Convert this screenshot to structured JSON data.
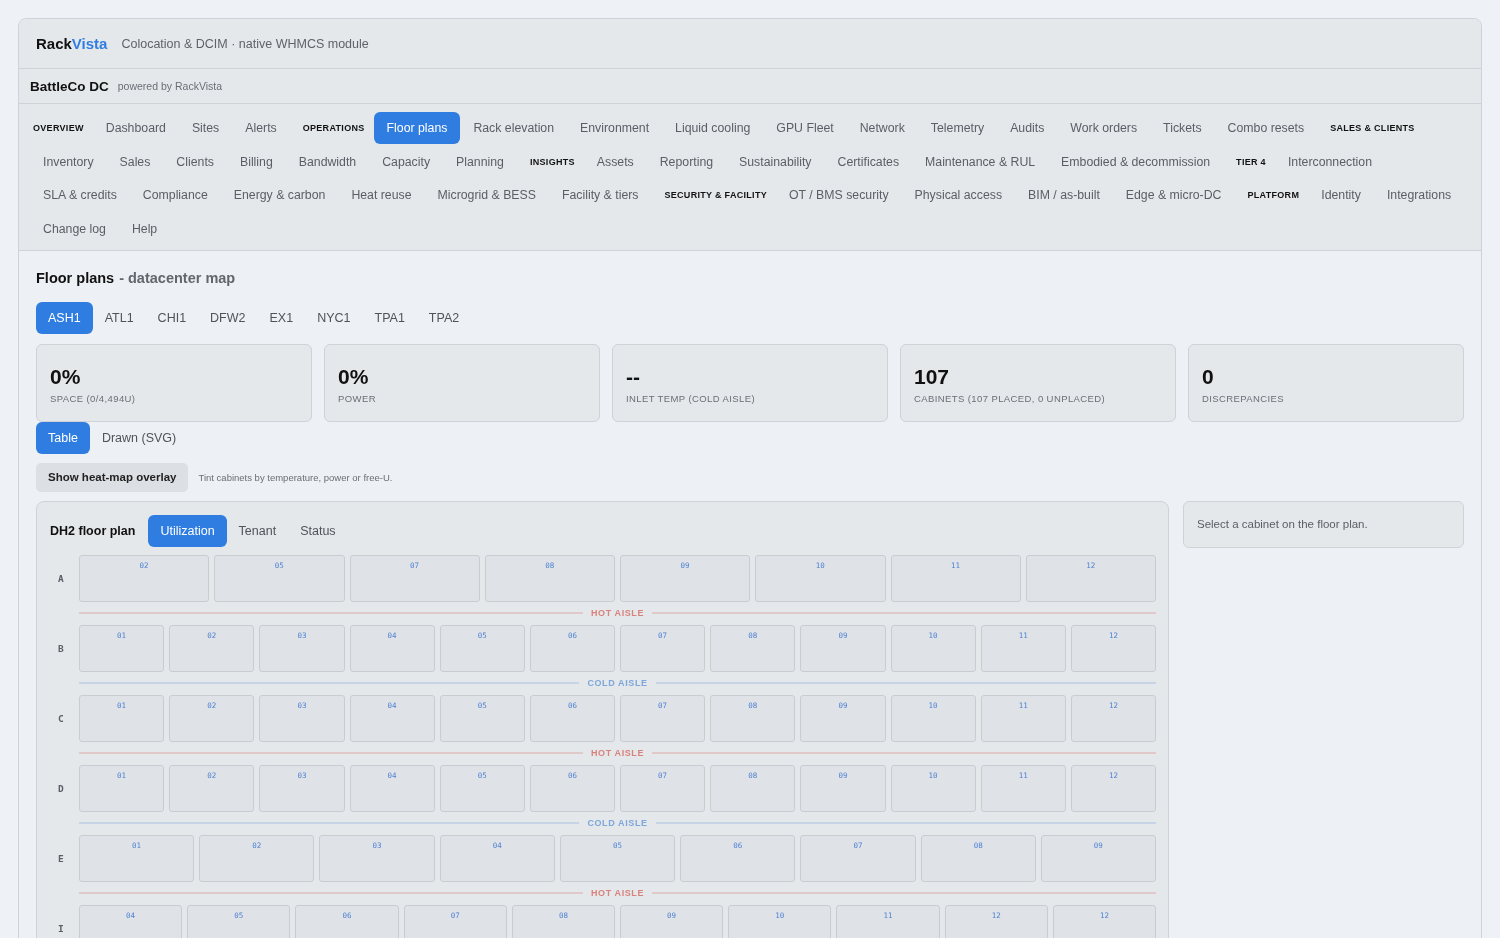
{
  "header": {
    "logo": {
      "prefix": "Rack",
      "accent": "Vista"
    },
    "tagline": "Colocation & DCIM · native WHMCS module"
  },
  "org": {
    "name": "BattleCo DC",
    "powered_by": "powered by RackVista"
  },
  "nav": {
    "items": [
      {
        "kind": "heading",
        "label": "OVERVIEW"
      },
      {
        "kind": "link",
        "label": "Dashboard",
        "selected": false
      },
      {
        "kind": "link",
        "label": "Sites",
        "selected": false
      },
      {
        "kind": "link",
        "label": "Alerts",
        "selected": false
      },
      {
        "kind": "heading",
        "label": "OPERATIONS"
      },
      {
        "kind": "link",
        "label": "Floor plans",
        "selected": true
      },
      {
        "kind": "link",
        "label": "Rack elevation",
        "selected": false
      },
      {
        "kind": "link",
        "label": "Environment",
        "selected": false
      },
      {
        "kind": "link",
        "label": "Liquid cooling",
        "selected": false
      },
      {
        "kind": "link",
        "label": "GPU Fleet",
        "selected": false
      },
      {
        "kind": "link",
        "label": "Network",
        "selected": false
      },
      {
        "kind": "link",
        "label": "Telemetry",
        "selected": false
      },
      {
        "kind": "link",
        "label": "Audits",
        "selected": false
      },
      {
        "kind": "link",
        "label": "Work orders",
        "selected": false
      },
      {
        "kind": "link",
        "label": "Tickets",
        "selected": false
      },
      {
        "kind": "link",
        "label": "Combo resets",
        "selected": false
      },
      {
        "kind": "heading",
        "label": "SALES & CLIENTS"
      },
      {
        "kind": "link",
        "label": "Inventory",
        "selected": false
      },
      {
        "kind": "link",
        "label": "Sales",
        "selected": false
      },
      {
        "kind": "link",
        "label": "Clients",
        "selected": false
      },
      {
        "kind": "link",
        "label": "Billing",
        "selected": false
      },
      {
        "kind": "link",
        "label": "Bandwidth",
        "selected": false
      },
      {
        "kind": "link",
        "label": "Capacity",
        "selected": false
      },
      {
        "kind": "link",
        "label": "Planning",
        "selected": false
      },
      {
        "kind": "heading",
        "label": "INSIGHTS"
      },
      {
        "kind": "link",
        "label": "Assets",
        "selected": false
      },
      {
        "kind": "link",
        "label": "Reporting",
        "selected": false
      },
      {
        "kind": "link",
        "label": "Sustainability",
        "selected": false
      },
      {
        "kind": "link",
        "label": "Certificates",
        "selected": false
      },
      {
        "kind": "link",
        "label": "Maintenance & RUL",
        "selected": false
      },
      {
        "kind": "link",
        "label": "Embodied & decommission",
        "selected": false
      },
      {
        "kind": "heading",
        "label": "TIER 4"
      },
      {
        "kind": "link",
        "label": "Interconnection",
        "selected": false
      },
      {
        "kind": "link",
        "label": "SLA & credits",
        "selected": false
      },
      {
        "kind": "link",
        "label": "Compliance",
        "selected": false
      },
      {
        "kind": "link",
        "label": "Energy & carbon",
        "selected": false
      },
      {
        "kind": "link",
        "label": "Heat reuse",
        "selected": false
      },
      {
        "kind": "link",
        "label": "Microgrid & BESS",
        "selected": false
      },
      {
        "kind": "link",
        "label": "Facility & tiers",
        "selected": false
      },
      {
        "kind": "heading",
        "label": "SECURITY & FACILITY"
      },
      {
        "kind": "link",
        "label": "OT / BMS security",
        "selected": false
      },
      {
        "kind": "link",
        "label": "Physical access",
        "selected": false
      },
      {
        "kind": "link",
        "label": "BIM / as-built",
        "selected": false
      },
      {
        "kind": "link",
        "label": "Edge & micro-DC",
        "selected": false
      },
      {
        "kind": "heading",
        "label": "PLATFORM"
      },
      {
        "kind": "link",
        "label": "Identity",
        "selected": false
      },
      {
        "kind": "link",
        "label": "Integrations",
        "selected": false
      },
      {
        "kind": "link",
        "label": "Change log",
        "selected": false
      },
      {
        "kind": "link",
        "label": "Help",
        "selected": false
      }
    ]
  },
  "page": {
    "title": "Floor plans",
    "subtitle": "- datacenter map"
  },
  "site_tabs": [
    {
      "label": "ASH1",
      "selected": true
    },
    {
      "label": "ATL1",
      "selected": false
    },
    {
      "label": "CHI1",
      "selected": false
    },
    {
      "label": "DFW2",
      "selected": false
    },
    {
      "label": "EX1",
      "selected": false
    },
    {
      "label": "NYC1",
      "selected": false
    },
    {
      "label": "TPA1",
      "selected": false
    },
    {
      "label": "TPA2",
      "selected": false
    }
  ],
  "stats": [
    {
      "value": "0%",
      "label": "SPACE (0/4,494U)"
    },
    {
      "value": "0%",
      "label": "POWER"
    },
    {
      "value": "--",
      "label": "INLET TEMP (COLD AISLE)"
    },
    {
      "value": "107",
      "label": "CABINETS (107 PLACED, 0 UNPLACED)"
    },
    {
      "value": "0",
      "label": "DISCREPANCIES"
    }
  ],
  "view_tabs": [
    {
      "label": "Table",
      "selected": true
    },
    {
      "label": "Drawn (SVG)",
      "selected": false
    }
  ],
  "heatmap": {
    "button": "Show heat-map overlay",
    "hint": "Tint cabinets by temperature, power or free-U."
  },
  "floor_plan": {
    "title": "DH2 floor plan",
    "modes": [
      {
        "label": "Utilization",
        "selected": true
      },
      {
        "label": "Tenant",
        "selected": false
      },
      {
        "label": "Status",
        "selected": false
      }
    ],
    "rows": [
      {
        "kind": "cabinets",
        "label": "A",
        "cabinets": [
          "02",
          "05",
          "07",
          "08",
          "09",
          "10",
          "11",
          "12"
        ]
      },
      {
        "kind": "aisle",
        "label": "HOT AISLE",
        "color": "#d9827d"
      },
      {
        "kind": "cabinets",
        "label": "B",
        "cabinets": [
          "01",
          "02",
          "03",
          "04",
          "05",
          "06",
          "07",
          "08",
          "09",
          "10",
          "11",
          "12"
        ]
      },
      {
        "kind": "aisle",
        "label": "COLD AISLE",
        "color": "#7ea6db"
      },
      {
        "kind": "cabinets",
        "label": "C",
        "cabinets": [
          "01",
          "02",
          "03",
          "04",
          "05",
          "06",
          "07",
          "08",
          "09",
          "10",
          "11",
          "12"
        ]
      },
      {
        "kind": "aisle",
        "label": "HOT AISLE",
        "color": "#d9827d"
      },
      {
        "kind": "cabinets",
        "label": "D",
        "cabinets": [
          "01",
          "02",
          "03",
          "04",
          "05",
          "06",
          "07",
          "08",
          "09",
          "10",
          "11",
          "12"
        ]
      },
      {
        "kind": "aisle",
        "label": "COLD AISLE",
        "color": "#7ea6db"
      },
      {
        "kind": "cabinets",
        "label": "E",
        "cabinets": [
          "01",
          "02",
          "03",
          "04",
          "05",
          "06",
          "07",
          "08",
          "09"
        ]
      },
      {
        "kind": "aisle",
        "label": "HOT AISLE",
        "color": "#d9827d"
      },
      {
        "kind": "cabinets",
        "label": "I",
        "cabinets": [
          "04",
          "05",
          "06",
          "07",
          "08",
          "09",
          "10",
          "11",
          "12",
          "12"
        ]
      }
    ]
  },
  "detail": {
    "message": "Select a cabinet on the floor plan."
  }
}
